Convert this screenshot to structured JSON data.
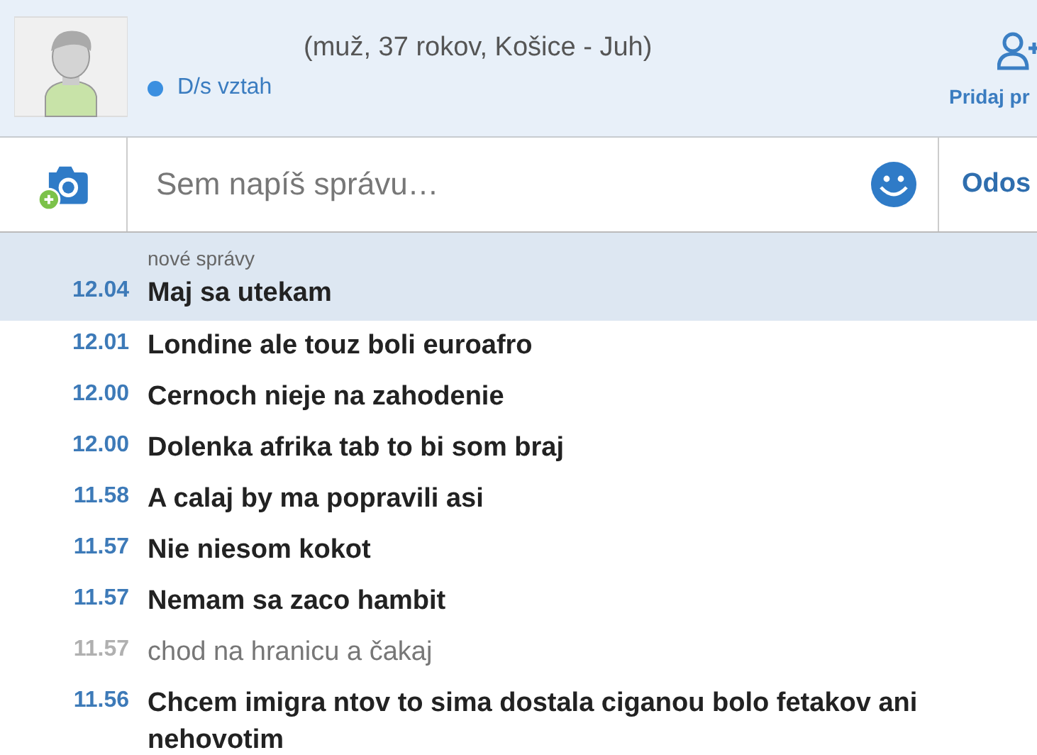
{
  "profile": {
    "details": "(muž, 37 rokov, Košice - Juh)",
    "status": {
      "label": "D/s vztah",
      "color": "#3b8fe0"
    },
    "add_button": "Pridaj pr"
  },
  "composer": {
    "placeholder": "Sem napíš správu…",
    "send_button": "Odos"
  },
  "new_section": {
    "label": "nové správy",
    "messages": [
      {
        "time": "12.04",
        "text": "Maj sa utekam",
        "own": false
      }
    ]
  },
  "messages": [
    {
      "time": "12.01",
      "text": "Londine ale touz boli euroafro",
      "own": false
    },
    {
      "time": "12.00",
      "text": "Cernoch nieje na zahodenie",
      "own": false
    },
    {
      "time": "12.00",
      "text": "Dolenka afrika tab to bi som braj",
      "own": false
    },
    {
      "time": "11.58",
      "text": "A calaj by ma popravili asi",
      "own": false
    },
    {
      "time": "11.57",
      "text": "Nie niesom kokot",
      "own": false
    },
    {
      "time": "11.57",
      "text": "Nemam sa zaco hambit",
      "own": false
    },
    {
      "time": "11.57",
      "text": "chod na hranicu a čakaj",
      "own": true
    },
    {
      "time": "11.56",
      "text": "Chcem imigra ntov to sima dostala ciganou bolo fetakov ani nehovotim",
      "own": false
    }
  ]
}
